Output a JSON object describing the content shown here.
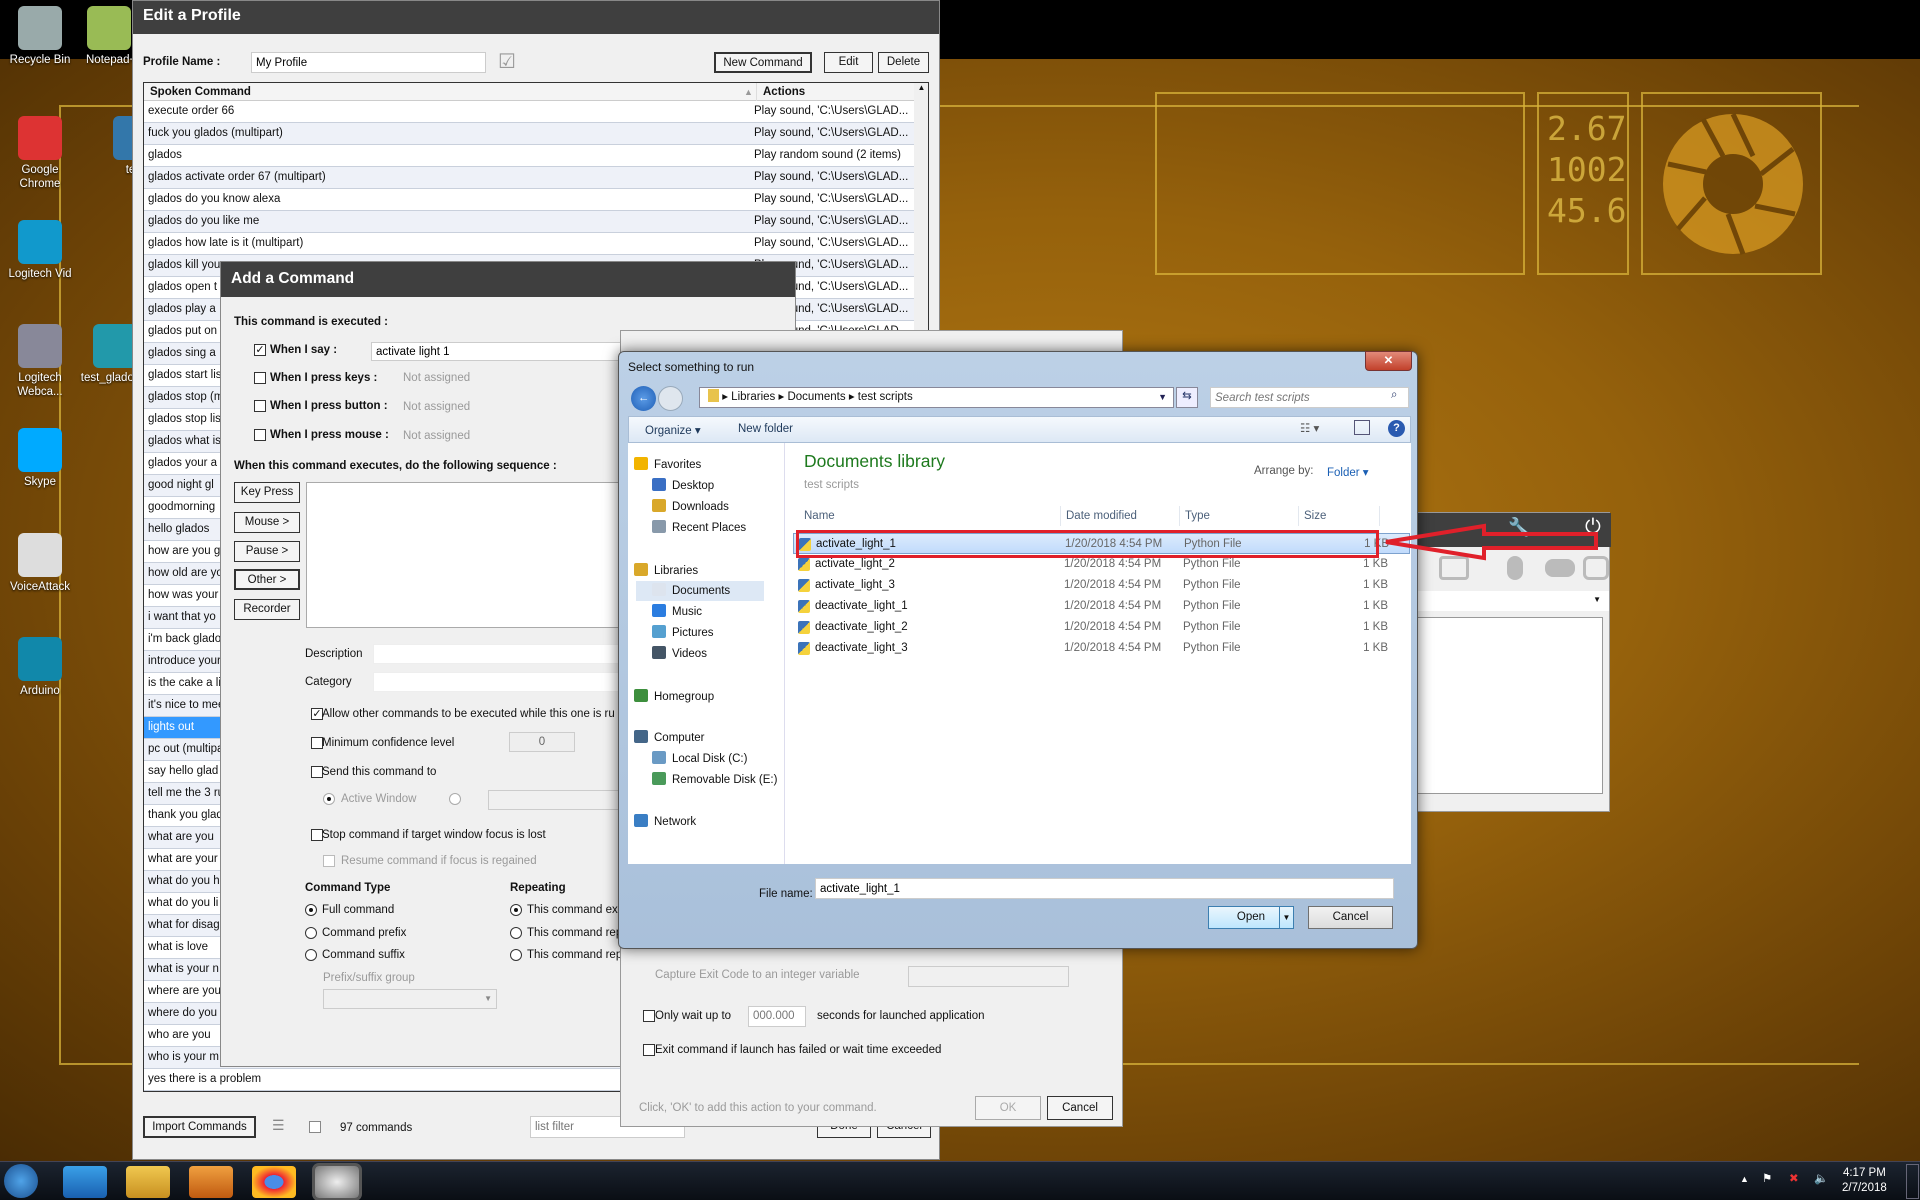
{
  "desktop": {
    "icons": [
      {
        "label": "Recycle Bin",
        "icon": "recycle-bin-icon"
      },
      {
        "label": "Notepad++",
        "icon": "notepad-icon"
      },
      {
        "label": "Google Chrome",
        "icon": "chrome-icon"
      },
      {
        "label": "test",
        "icon": "python-file-icon"
      },
      {
        "label": "Logitech Vid",
        "icon": "logitech-vid-icon"
      },
      {
        "label": "Logitech Webca...",
        "icon": "webcam-icon"
      },
      {
        "label": "test_glados 2",
        "icon": "arduino-file-icon"
      },
      {
        "label": "Skype",
        "icon": "skype-icon"
      },
      {
        "label": "VoiceAttack",
        "icon": "voiceattack-icon"
      },
      {
        "label": "Arduino",
        "icon": "arduino-icon"
      }
    ],
    "wallpaper_readout": [
      "2.67",
      "1002",
      "45.6"
    ],
    "accent": "#d8b33a"
  },
  "edit_profile": {
    "title": "Edit a Profile",
    "profile_name_label": "Profile Name :",
    "profile_name_value": "My Profile",
    "new_command": "New Command",
    "edit": "Edit",
    "delete": "Delete",
    "col_spoken": "Spoken Command",
    "col_actions": "Actions",
    "commands": [
      {
        "spoken": "execute order 66",
        "action": "Play sound, 'C:\\Users\\GLAD..."
      },
      {
        "spoken": "fuck you glados (multipart)",
        "action": "Play sound, 'C:\\Users\\GLAD..."
      },
      {
        "spoken": "glados",
        "action": "Play random sound (2 items)"
      },
      {
        "spoken": "glados activate order 67 (multipart)",
        "action": "Play sound, 'C:\\Users\\GLAD..."
      },
      {
        "spoken": "glados do you know alexa",
        "action": "Play sound, 'C:\\Users\\GLAD..."
      },
      {
        "spoken": "glados do you like me",
        "action": "Play sound, 'C:\\Users\\GLAD..."
      },
      {
        "spoken": "glados how late is it (multipart)",
        "action": "Play sound, 'C:\\Users\\GLAD..."
      },
      {
        "spoken": "glados kill you",
        "action": "Play sound, 'C:\\Users\\GLAD..."
      },
      {
        "spoken": "glados open t",
        "action": "Play sound, 'C:\\Users\\GLAD..."
      },
      {
        "spoken": "glados play a",
        "action": "Play sound, 'C:\\Users\\GLAD..."
      },
      {
        "spoken": "glados put on",
        "action": "Play sound, 'C:\\Users\\GLAD..."
      },
      {
        "spoken": "glados sing a",
        "action": ""
      },
      {
        "spoken": "glados start lis",
        "action": ""
      },
      {
        "spoken": "glados stop (m",
        "action": ""
      },
      {
        "spoken": "glados stop lis",
        "action": ""
      },
      {
        "spoken": "glados what is",
        "action": ""
      },
      {
        "spoken": "glados your a",
        "action": ""
      },
      {
        "spoken": "good night gl",
        "action": ""
      },
      {
        "spoken": "goodmorning",
        "action": ""
      },
      {
        "spoken": "hello glados",
        "action": ""
      },
      {
        "spoken": "how are you g",
        "action": ""
      },
      {
        "spoken": "how old are yo",
        "action": ""
      },
      {
        "spoken": "how was your",
        "action": ""
      },
      {
        "spoken": "i want that yo",
        "action": ""
      },
      {
        "spoken": "i'm back glado",
        "action": ""
      },
      {
        "spoken": "introduce your",
        "action": ""
      },
      {
        "spoken": "is the cake a li",
        "action": ""
      },
      {
        "spoken": "it's nice to mee",
        "action": ""
      },
      {
        "spoken": "lights out",
        "action": "",
        "selected": true
      },
      {
        "spoken": "pc out (multipa",
        "action": ""
      },
      {
        "spoken": "say hello glad",
        "action": ""
      },
      {
        "spoken": "tell me the 3 ru",
        "action": ""
      },
      {
        "spoken": "thank you glad",
        "action": ""
      },
      {
        "spoken": "what are you",
        "action": ""
      },
      {
        "spoken": "what are your",
        "action": ""
      },
      {
        "spoken": "what do you h",
        "action": ""
      },
      {
        "spoken": "what do you li",
        "action": ""
      },
      {
        "spoken": "what for disag",
        "action": ""
      },
      {
        "spoken": "what is love",
        "action": ""
      },
      {
        "spoken": "what is your n",
        "action": ""
      },
      {
        "spoken": "where are you",
        "action": ""
      },
      {
        "spoken": "where do you",
        "action": ""
      },
      {
        "spoken": "who are you",
        "action": ""
      },
      {
        "spoken": "who is your m",
        "action": ""
      },
      {
        "spoken": "yes there is a problem",
        "action": ""
      }
    ],
    "import_commands": "Import Commands",
    "count": "97 commands",
    "filter_placeholder": "list filter",
    "done": "Done",
    "cancel": "Cancel",
    "selected_color": "#3399ff"
  },
  "add_command": {
    "title": "Add a Command",
    "executed_label": "This command is executed :",
    "when_say": "When I say :",
    "when_say_value": "activate light 1",
    "when_say_checked": true,
    "when_keys": "When I press keys :",
    "when_button": "When I press button :",
    "when_mouse": "When I press mouse :",
    "not_assigned": "Not assigned",
    "sequence_label": "When this command executes, do the following sequence :",
    "buttons": [
      "Key Press",
      "Mouse >",
      "Pause >",
      "Other >",
      "Recorder"
    ],
    "description": "Description",
    "category": "Category",
    "allow_other": "Allow other commands to be executed while this one is ru",
    "min_confidence": "Minimum confidence level",
    "min_confidence_value": "0",
    "send_to": "Send this command to",
    "active_window": "Active Window",
    "stop_focus": "Stop command if target window focus is lost",
    "resume_focus": "Resume command if focus is regained",
    "command_type": "Command Type",
    "full_command": "Full command",
    "prefix": "Command prefix",
    "suffix": "Command suffix",
    "prefix_group": "Prefix/suffix group",
    "repeating": "Repeating",
    "rep1": "This command exe",
    "rep2": "This command rep",
    "rep3": "This command rep"
  },
  "launch_dialog": {
    "capture_exit": "Capture Exit Code to an integer variable",
    "only_wait": "Only wait up to",
    "wait_value": "000.000",
    "wait_suffix": "seconds for launched application",
    "exit_failed": "Exit command if launch has failed or wait time exceeded",
    "hint": "Click, 'OK' to add this action to your command.",
    "ok": "OK",
    "cancel": "Cancel"
  },
  "file_dialog": {
    "title": "Select something to run",
    "breadcrumb": [
      "Libraries",
      "Documents",
      "test scripts"
    ],
    "search_placeholder": "Search test scripts",
    "organize": "Organize",
    "new_folder": "New folder",
    "nav": [
      {
        "label": "Favorites",
        "icon": "star-icon",
        "level": 0
      },
      {
        "label": "Desktop",
        "icon": "desktop-icon",
        "level": 1
      },
      {
        "label": "Downloads",
        "icon": "downloads-icon",
        "level": 1
      },
      {
        "label": "Recent Places",
        "icon": "recent-places-icon",
        "level": 1
      },
      {
        "label": "Libraries",
        "icon": "libraries-icon",
        "level": 0
      },
      {
        "label": "Documents",
        "icon": "documents-icon",
        "level": 1,
        "selected": true
      },
      {
        "label": "Music",
        "icon": "music-icon",
        "level": 1
      },
      {
        "label": "Pictures",
        "icon": "pictures-icon",
        "level": 1
      },
      {
        "label": "Videos",
        "icon": "videos-icon",
        "level": 1
      },
      {
        "label": "Homegroup",
        "icon": "homegroup-icon",
        "level": 0
      },
      {
        "label": "Computer",
        "icon": "computer-icon",
        "level": 0
      },
      {
        "label": "Local Disk (C:)",
        "icon": "local-disk-icon",
        "level": 1
      },
      {
        "label": "Removable Disk (E:)",
        "icon": "removable-disk-icon",
        "level": 1
      },
      {
        "label": "Network",
        "icon": "network-icon",
        "level": 0
      }
    ],
    "library_title": "Documents library",
    "library_sub": "test scripts",
    "arrange_by": "Arrange by:",
    "arrange_value": "Folder",
    "columns": [
      "Name",
      "Date modified",
      "Type",
      "Size"
    ],
    "files": [
      {
        "name": "activate_light_1",
        "date": "1/20/2018 4:54 PM",
        "type": "Python File",
        "size": "1 KB",
        "selected": true
      },
      {
        "name": "activate_light_2",
        "date": "1/20/2018 4:54 PM",
        "type": "Python File",
        "size": "1 KB"
      },
      {
        "name": "activate_light_3",
        "date": "1/20/2018 4:54 PM",
        "type": "Python File",
        "size": "1 KB"
      },
      {
        "name": "deactivate_light_1",
        "date": "1/20/2018 4:54 PM",
        "type": "Python File",
        "size": "1 KB"
      },
      {
        "name": "deactivate_light_2",
        "date": "1/20/2018 4:54 PM",
        "type": "Python File",
        "size": "1 KB"
      },
      {
        "name": "deactivate_light_3",
        "date": "1/20/2018 4:54 PM",
        "type": "Python File",
        "size": "1 KB"
      }
    ],
    "file_name_label": "File name:",
    "file_name_value": "activate_light_1",
    "open": "Open",
    "cancel": "Cancel",
    "annotation_color": "#e0202a"
  },
  "taskbar": {
    "apps": [
      "start-orb-icon",
      "internet-explorer-icon",
      "file-explorer-icon",
      "media-player-icon",
      "chrome-icon",
      "voiceattack-icon"
    ],
    "time": "4:17 PM",
    "date": "2/7/2018"
  }
}
